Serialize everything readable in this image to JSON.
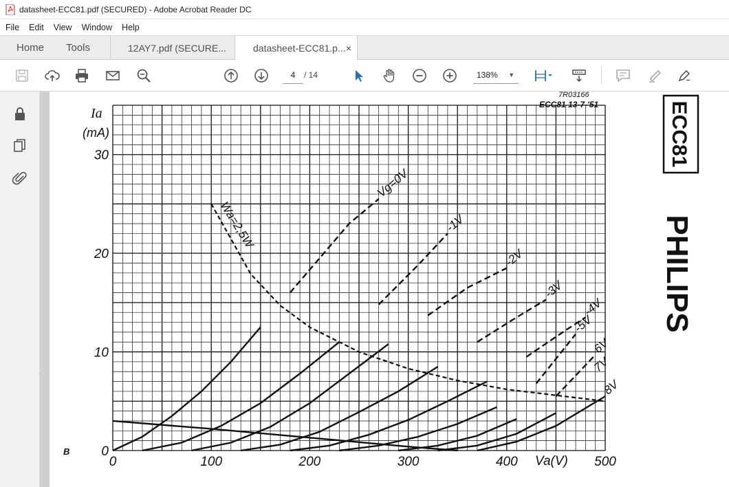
{
  "window": {
    "title": "datasheet-ECC81.pdf (SECURED) - Adobe Acrobat Reader DC"
  },
  "menu": [
    "File",
    "Edit",
    "View",
    "Window",
    "Help"
  ],
  "tabs": {
    "home": "Home",
    "tools": "Tools",
    "doc1": "12AY7.pdf (SECURE...",
    "doc2": "datasheet-ECC81.p...",
    "close": "×"
  },
  "toolbar": {
    "page_current": "4",
    "page_total": "/ 14",
    "zoom": "138%"
  },
  "icons": {
    "save": "save-icon",
    "upload": "cloud-upload-icon",
    "print": "print-icon",
    "mail": "mail-icon",
    "search": "search-zoom-icon",
    "prev": "arrow-up-circle-icon",
    "next": "arrow-down-circle-icon",
    "select": "pointer-icon",
    "hand": "hand-icon",
    "zoom_out": "zoom-out-icon",
    "zoom_in": "zoom-in-icon",
    "fit": "fit-page-icon",
    "scroll": "scroll-mode-icon",
    "comment": "comment-icon",
    "highlight": "highlight-icon",
    "sign": "sign-icon",
    "lock": "lock-icon",
    "pages": "pages-icon",
    "attach": "attachment-icon"
  },
  "accent": "#2a6ebd",
  "document": {
    "ref_code": "7R03166",
    "ref_date": "ECC81 13-7-'51",
    "tube_label": "ECC81",
    "brand": "PHILIPS",
    "y_axis_label": "Ia",
    "y_axis_unit": "(mA)",
    "x_axis_label": "Va(V)",
    "corner_mark": "B",
    "power_curve_label": "Wa=2,5W"
  },
  "chart_data": {
    "type": "line",
    "title": "",
    "xlabel": "Va(V)",
    "ylabel": "Ia (mA)",
    "xlim": [
      0,
      500
    ],
    "ylim": [
      0,
      35
    ],
    "x_ticks": [
      0,
      100,
      200,
      300,
      400,
      500
    ],
    "y_ticks": [
      0,
      10,
      20,
      30
    ],
    "grid": true,
    "series": [
      {
        "name": "Vg=0V",
        "x": [
          0,
          30,
          60,
          90,
          120,
          150,
          180,
          210,
          240,
          270
        ],
        "y": [
          0,
          1.4,
          3.5,
          6.0,
          9.0,
          12.5,
          16.0,
          19.5,
          23.0,
          25.5
        ],
        "dashed_from": 170
      },
      {
        "name": "-1V",
        "x": [
          30,
          70,
          110,
          150,
          190,
          230,
          270,
          310,
          340
        ],
        "y": [
          0,
          0.8,
          2.5,
          4.8,
          7.8,
          11.0,
          14.8,
          18.8,
          22.0
        ],
        "dashed_from": 240
      },
      {
        "name": "-2V",
        "x": [
          80,
          120,
          160,
          200,
          240,
          280,
          320,
          360,
          400
        ],
        "y": [
          0,
          0.8,
          2.4,
          4.8,
          7.8,
          10.8,
          13.7,
          16.5,
          18.5
        ],
        "dashed_from": 300
      },
      {
        "name": "-3V",
        "x": [
          130,
          170,
          210,
          250,
          290,
          330,
          370,
          410,
          440
        ],
        "y": [
          0,
          0.6,
          1.9,
          3.9,
          6.0,
          8.5,
          11.0,
          13.5,
          15.3
        ],
        "dashed_from": 350
      },
      {
        "name": "-4V",
        "x": [
          180,
          220,
          260,
          300,
          340,
          380,
          420,
          460,
          480
        ],
        "y": [
          0,
          0.5,
          1.6,
          3.1,
          5.0,
          7.0,
          9.5,
          12.2,
          13.5
        ],
        "dashed_from": 390
      },
      {
        "name": "-5V",
        "x": [
          230,
          270,
          310,
          350,
          390,
          430,
          470
        ],
        "y": [
          0,
          0.5,
          1.4,
          2.7,
          4.4,
          6.8,
          11.8
        ],
        "dashed_from": 420
      },
      {
        "name": "6V",
        "x": [
          290,
          330,
          370,
          410,
          450,
          490
        ],
        "y": [
          0,
          0.5,
          1.5,
          3.2,
          5.5,
          9.7
        ],
        "dashed_from": 440
      },
      {
        "name": "7V",
        "x": [
          330,
          370,
          410,
          450,
          490
        ],
        "y": [
          0,
          0.5,
          1.7,
          3.8,
          7.8
        ],
        "dashed_from": 470
      },
      {
        "name": "8V",
        "x": [
          370,
          410,
          450,
          500
        ],
        "y": [
          0,
          0.9,
          2.5,
          5.5
        ],
        "dashed_from": 999
      },
      {
        "name": "Wa=2,5W",
        "x": [
          100,
          140,
          170,
          200,
          250,
          300,
          350,
          400,
          450,
          500
        ],
        "y": [
          25.0,
          17.9,
          14.7,
          12.5,
          10.0,
          8.3,
          7.1,
          6.2,
          5.6,
          5.0
        ],
        "dashed_from": 0
      },
      {
        "name": "load line",
        "x": [
          0,
          100,
          200,
          300,
          350
        ],
        "y": [
          3.0,
          2.2,
          1.3,
          0.4,
          0
        ],
        "dashed_from": 999
      }
    ]
  }
}
